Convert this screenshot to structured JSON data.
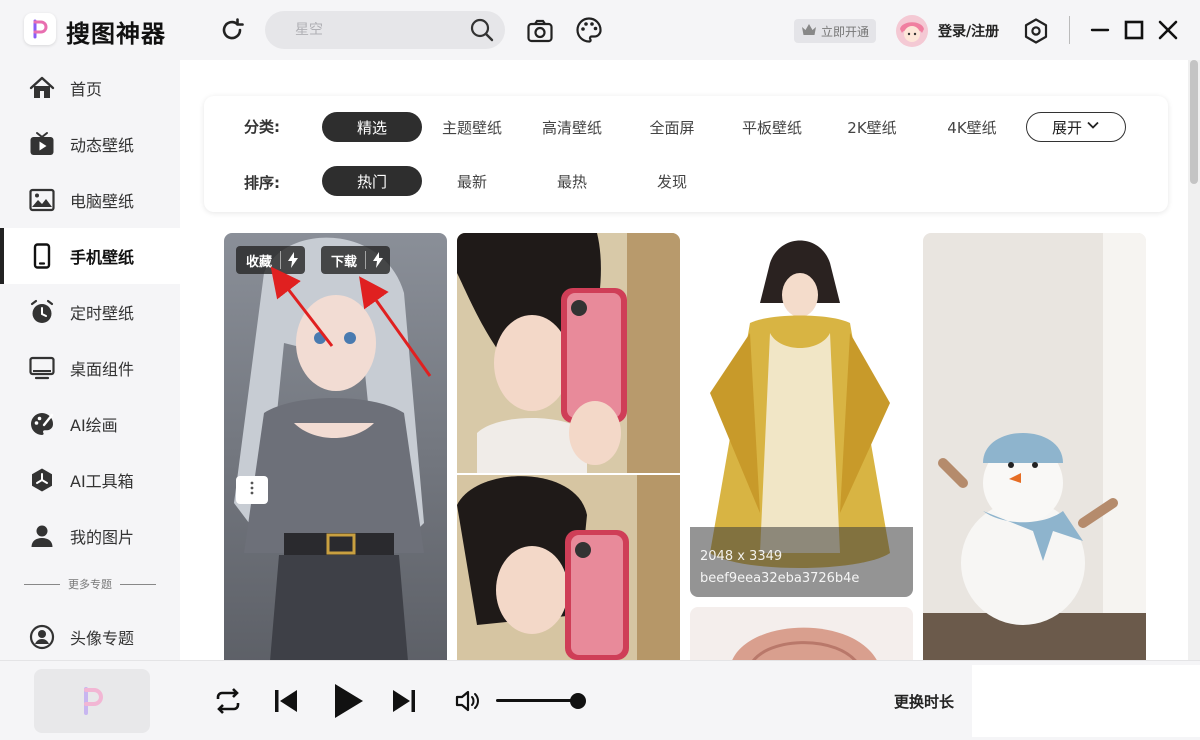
{
  "app": {
    "title": "搜图神器"
  },
  "search": {
    "placeholder": "星空"
  },
  "header": {
    "vip_label": "立即开通",
    "login_label": "登录/注册"
  },
  "sidebar": {
    "items": [
      {
        "label": "首页",
        "icon": "home-icon"
      },
      {
        "label": "动态壁纸",
        "icon": "tv-play-icon"
      },
      {
        "label": "电脑壁纸",
        "icon": "image-icon"
      },
      {
        "label": "手机壁纸",
        "icon": "phone-icon",
        "active": true
      },
      {
        "label": "定时壁纸",
        "icon": "alarm-clock-icon"
      },
      {
        "label": "桌面组件",
        "icon": "monitor-icon"
      },
      {
        "label": "AI绘画",
        "icon": "ai-palette-icon"
      },
      {
        "label": "AI工具箱",
        "icon": "ai-toolbox-icon"
      },
      {
        "label": "我的图片",
        "icon": "user-icon"
      }
    ],
    "more_topics": "更多专题",
    "topic_items": [
      {
        "label": "头像专题",
        "icon": "avatar-circle-icon"
      }
    ]
  },
  "filters": {
    "category_label": "分类:",
    "categories": [
      "精选",
      "主题壁纸",
      "高清壁纸",
      "全面屏",
      "平板壁纸",
      "2K壁纸",
      "4K壁纸"
    ],
    "expand_label": "展开",
    "sort_label": "排序:",
    "sorts": [
      "热门",
      "最新",
      "最热",
      "发现"
    ]
  },
  "card_actions": {
    "favorite": "收藏",
    "download": "下载"
  },
  "cards": [
    {
      "resolution": "2048 x 3349",
      "hash": "beef9eea32eba3726b4e"
    }
  ],
  "player": {
    "change_duration": "更换时长"
  },
  "colors": {
    "accent": "#2e2e2e",
    "arrow": "#e02020",
    "background": "#f5f5f7"
  }
}
